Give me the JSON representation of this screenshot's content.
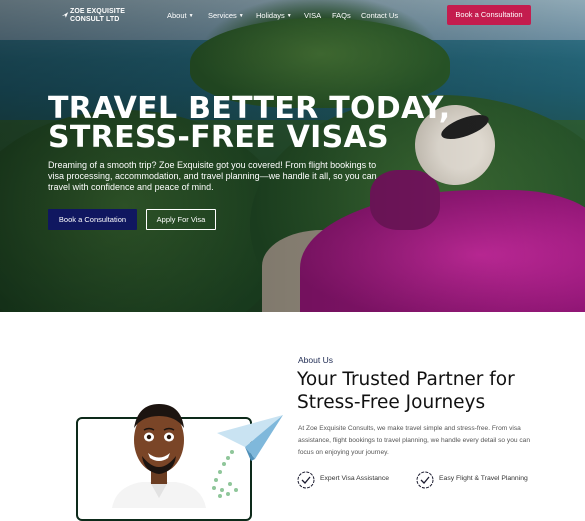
{
  "brand": {
    "name_line1": "ZOE EXQUISITE",
    "name_line2": "CONSULT LTD"
  },
  "nav": {
    "items": [
      {
        "label": "About",
        "has_menu": true
      },
      {
        "label": "Services",
        "has_menu": true
      },
      {
        "label": "Holidays",
        "has_menu": true
      },
      {
        "label": "VISA",
        "has_menu": false
      },
      {
        "label": "FAQs",
        "has_menu": false
      },
      {
        "label": "Contact Us",
        "has_menu": false
      }
    ],
    "cta_label": "Book a Consultation"
  },
  "hero": {
    "title_line1": "TRAVEL BETTER TODAY,",
    "title_line2": "STRESS-FREE VISAS",
    "subtitle": "Dreaming of a smooth trip? Zoe Exquisite got you covered! From flight bookings to visa processing, accommodation, and travel planning—we handle it all, so you can travel with confidence and peace of mind.",
    "primary_button": "Book a Consultation",
    "secondary_button": "Apply For Visa"
  },
  "about": {
    "eyebrow": "About Us",
    "title_line1": "Your Trusted Partner for",
    "title_line2": "Stress-Free Journeys",
    "body": "At Zoe Exquisite Consults, we make travel simple and stress-free. From visa assistance, flight bookings to travel planning, we handle every detail so you can focus on enjoying your journey.",
    "features": [
      {
        "label": "Expert Visa Assistance",
        "icon": "check-circle-icon"
      },
      {
        "label": "Easy Flight & Travel Planning",
        "icon": "check-circle-icon"
      }
    ]
  },
  "colors": {
    "accent_red": "#c41c4e",
    "navy": "#101760",
    "heading_dark": "#111111",
    "eyebrow_blue": "#1e2a52"
  }
}
